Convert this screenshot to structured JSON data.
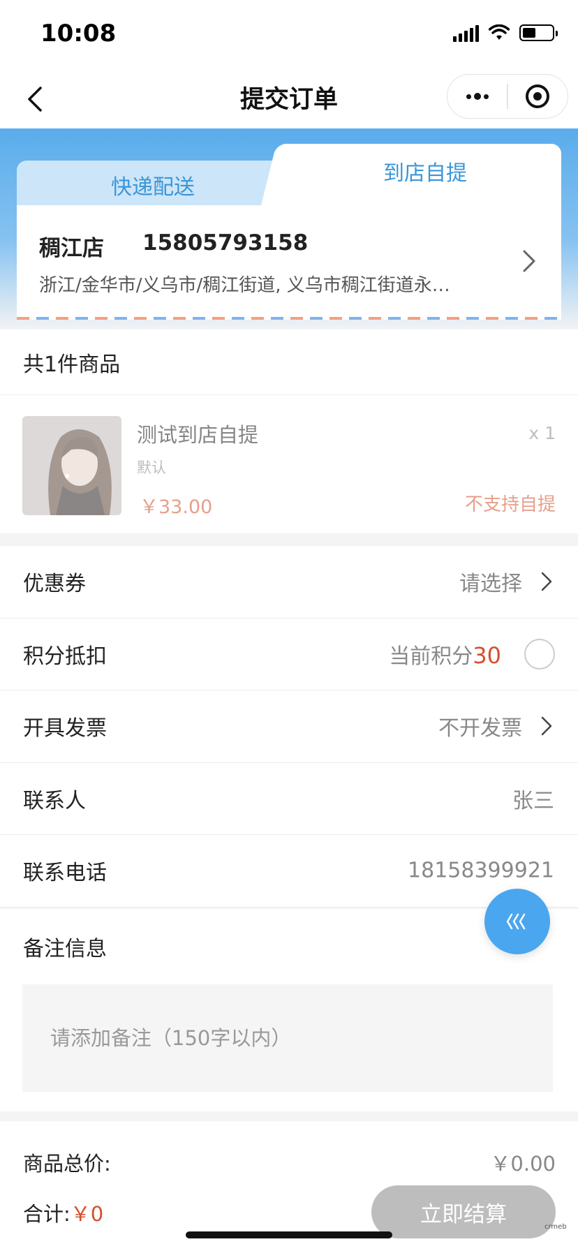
{
  "status_bar": {
    "time": "10:08",
    "battery_level": 0.45
  },
  "nav": {
    "title": "提交订单",
    "back_icon": "chevron-left-icon",
    "more_icon": "more-dots-icon",
    "close_icon": "target-icon"
  },
  "delivery_tabs": {
    "express": "快递配送",
    "pickup": "到店自提",
    "active": "到店自提"
  },
  "store": {
    "name": "稠江店",
    "phone": "15805793158",
    "address": "浙江/金华市/义乌市/稠江街道, 义乌市稠江街道永…"
  },
  "products": {
    "count_label": "共1件商品",
    "items": [
      {
        "name": "测试到店自提",
        "spec": "默认",
        "price": "￥33.00",
        "qty": "x 1",
        "status": "不支持自提"
      }
    ]
  },
  "options": {
    "coupon": {
      "label": "优惠券",
      "value": "请选择"
    },
    "points": {
      "label": "积分抵扣",
      "prefix": "当前积分",
      "value": "30"
    },
    "invoice": {
      "label": "开具发票",
      "value": "不开发票"
    },
    "contact": {
      "label": "联系人",
      "value": "张三"
    },
    "phone": {
      "label": "联系电话",
      "value": "18158399921"
    }
  },
  "remark": {
    "label": "备注信息",
    "placeholder": "请添加备注（150字以内）"
  },
  "summary": {
    "total_label": "商品总价:",
    "total_value": "￥0.00",
    "sum_label": "合计:",
    "sum_value": "￥0"
  },
  "checkout": {
    "label": "立即结算"
  },
  "watermark": "crmeb",
  "colors": {
    "accent": "#4aa6ee",
    "price": "#d2512d",
    "disabled": "#bdbdbd"
  }
}
